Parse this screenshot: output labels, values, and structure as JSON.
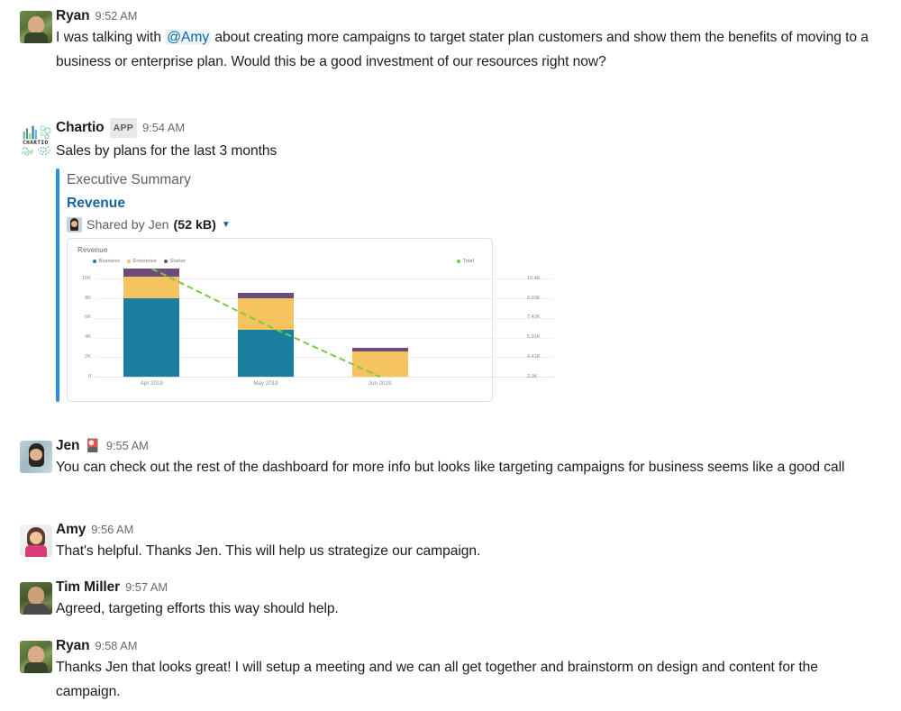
{
  "theme": {
    "text_primary": "#1d1c1d",
    "text_muted": "#616061",
    "link_blue": "#1264a3",
    "attachment_bar": "#2d8fd5",
    "mention_bg": "#e8f5fa"
  },
  "messages": [
    {
      "author": "Ryan",
      "timestamp": "9:52 AM",
      "avatar": "ryan-photo",
      "badge": null,
      "app_tag": null,
      "text_parts": [
        {
          "kind": "text",
          "value": "I was talking with "
        },
        {
          "kind": "mention",
          "value": "@Amy"
        },
        {
          "kind": "text",
          "value": " about creating more campaigns to target stater plan customers and show them the benefits of moving to a business or enterprise plan. Would this be a good investment of our resources right now?"
        }
      ]
    },
    {
      "author": "Chartio",
      "timestamp": "9:54 AM",
      "avatar": "chartio-logo",
      "app_tag": "APP",
      "text": "Sales by plans for the last 3 months",
      "attachment": {
        "pretext": "Executive Summary",
        "title": "Revenue",
        "shared_by": "Shared by Jen",
        "file_size": "(52 kB)",
        "caret_icon": "chevron-down-icon"
      }
    },
    {
      "author": "Jen",
      "timestamp": "9:55 AM",
      "avatar": "jen-photo",
      "badge": "🎴",
      "text": "You can check out the rest of the dashboard for more info but looks like targeting campaigns for business seems like a good call"
    },
    {
      "author": "Amy",
      "timestamp": "9:56 AM",
      "avatar": "amy-photo",
      "text": "That's helpful. Thanks Jen. This will help us strategize our campaign."
    },
    {
      "author": "Tim Miller",
      "timestamp": "9:57 AM",
      "avatar": "tim-photo",
      "text": "Agreed, targeting efforts this way should help."
    },
    {
      "author": "Ryan",
      "timestamp": "9:58 AM",
      "avatar": "ryan-photo",
      "text": "Thanks Jen that looks great! I will setup a meeting and we can all get together and brainstorm on design and content for the campaign."
    }
  ],
  "chart_data": {
    "type": "bar",
    "stacked": true,
    "title": "Revenue",
    "xlabel": "",
    "ylabel": "",
    "grid": true,
    "legend_position": "top",
    "categories": [
      "Apr 2019",
      "May 2019",
      "Jun 2019"
    ],
    "series": [
      {
        "name": "Business",
        "color": "#1b7e9e",
        "values": [
          8000,
          4750,
          0
        ]
      },
      {
        "name": "Enterprise",
        "color": "#f5c45e",
        "values": [
          2250,
          3300,
          2600
        ]
      },
      {
        "name": "Starter",
        "color": "#6b4c7c",
        "values": [
          800,
          500,
          350
        ]
      }
    ],
    "line_series": {
      "name": "Total",
      "color": "#7ac943",
      "style": "dashed",
      "values": [
        10400,
        6500,
        2900
      ]
    },
    "y_axis_left": {
      "ticks": [
        "0",
        "2K",
        "4K",
        "6K",
        "8K",
        "10K"
      ],
      "range": [
        0,
        11050
      ]
    },
    "y_axis_right": {
      "ticks": [
        "2.9K",
        "4.41K",
        "5.91K",
        "7.42K",
        "8.93K",
        "10.4K"
      ],
      "range": [
        2900,
        10400
      ]
    }
  }
}
